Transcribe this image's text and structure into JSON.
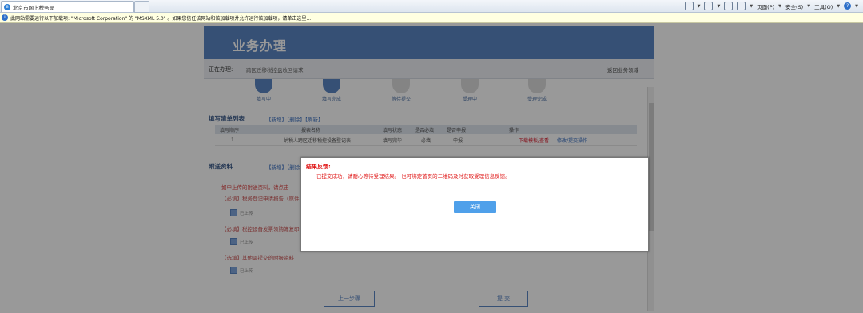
{
  "browser": {
    "tab_title": "北京市网上税务局",
    "commands": {
      "page": "页面(P)",
      "safety": "安全(S)",
      "tools": "工具(O)"
    },
    "infobar_text": "此网站需要运行以下加载项: \"Microsoft Corporation\" 的 \"MSXML 5.0\" 。如果您信任该网站和该加载项并允许运行该加载项，请单击这里..."
  },
  "page": {
    "banner_title": "业务办理",
    "crumb_label": "正在办理:",
    "crumb_value": "跨区迁移税控盘收回请求",
    "crumb_link": "返回业务领域",
    "steps": [
      {
        "label": "填写中",
        "state": "done"
      },
      {
        "label": "填写完成",
        "state": "done"
      },
      {
        "label": "等待提交",
        "state": "todo"
      },
      {
        "label": "受理中",
        "state": "todo"
      },
      {
        "label": "受理完成",
        "state": "todo"
      }
    ],
    "fill_list": {
      "title": "填写清单列表",
      "actions": "【新增】【删除】【刷新】",
      "headers": [
        "填写顺序",
        "报表名称",
        "填写状态",
        "是否必填",
        "是否申报",
        "操作"
      ],
      "row": {
        "order": "1",
        "name": "纳税人跨区迁移税控设备登记表",
        "status": "填写完毕",
        "required": "必填",
        "declare": "申报",
        "op1": "下载模板/查看",
        "op2": "修改/提交操作"
      }
    },
    "attachments": {
      "title": "附送资料",
      "actions": "【新增】【删除】",
      "notes": [
        "如申上传的附送资料，请点击",
        "【必填】税务登记申请报告（原件）",
        "【必填】税控设备发票领购簿复印件",
        "【选填】其他需提交的附报资料"
      ],
      "check_label": "已上传"
    },
    "buttons": {
      "prev": "上一步骤",
      "next": "提  交"
    }
  },
  "modal": {
    "title": "结果反馈:",
    "message": "已提交成功，请耐心等待受理结果。  也可绑定首页的二维码及时获取受理信息反馈。",
    "close_button": "关闭"
  }
}
